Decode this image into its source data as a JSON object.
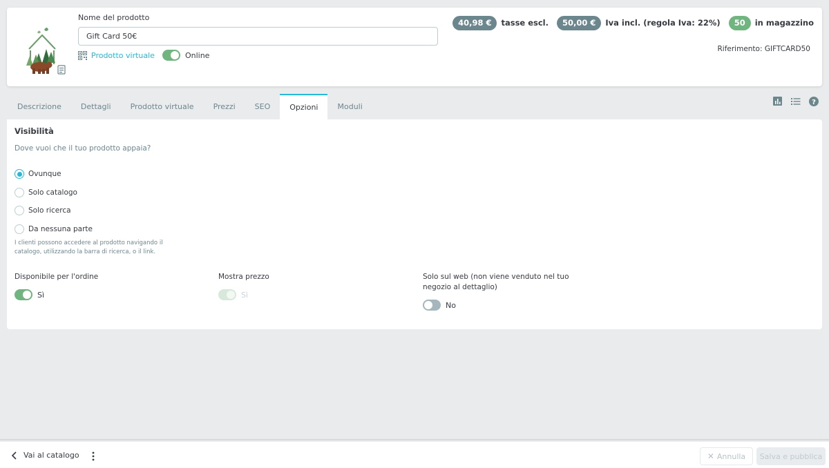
{
  "header": {
    "name_label": "Nome del prodotto",
    "name_value": "Gift Card 50€",
    "virtual_link": "Prodotto virtuale",
    "online_label": "Online",
    "online_enabled": true,
    "price_excl": "40,98 €",
    "price_excl_label": "tasse escl.",
    "price_incl": "50,00 €",
    "price_incl_label": "Iva incl. (regola Iva: 22%)",
    "stock": "50",
    "stock_label": "in magazzino",
    "reference": "Riferimento: GIFTCARD50"
  },
  "tabs": [
    {
      "label": "Descrizione",
      "active": false
    },
    {
      "label": "Dettagli",
      "active": false
    },
    {
      "label": "Prodotto virtuale",
      "active": false
    },
    {
      "label": "Prezzi",
      "active": false
    },
    {
      "label": "SEO",
      "active": false
    },
    {
      "label": "Opzioni",
      "active": true
    },
    {
      "label": "Moduli",
      "active": false
    }
  ],
  "tab_tools": [
    "bar-chart-icon",
    "list-icon",
    "help-icon"
  ],
  "visibility": {
    "title": "Visibilità",
    "question": "Dove vuoi che il tuo prodotto appaia?",
    "options": [
      "Ovunque",
      "Solo catalogo",
      "Solo ricerca",
      "Da nessuna parte"
    ],
    "selected_index": 0,
    "help": "I clienti possono accedere al prodotto navigando il catalogo, utilizzando la barra di ricerca, o il link."
  },
  "options": {
    "available_label": "Disponibile per l'ordine",
    "available_value": "Sì",
    "show_price_label": "Mostra prezzo",
    "show_price_value": "Sì",
    "web_only_label": "Solo sul web (non viene venduto nel tuo negozio al dettaglio)",
    "web_only_value": "No"
  },
  "footer": {
    "back_label": "Vai al catalogo",
    "cancel_label": "Annulla",
    "save_label": "Salva e pubblica"
  },
  "colors": {
    "accent": "#25b9d7",
    "success": "#70b580",
    "pill_gray": "#6c868e"
  }
}
